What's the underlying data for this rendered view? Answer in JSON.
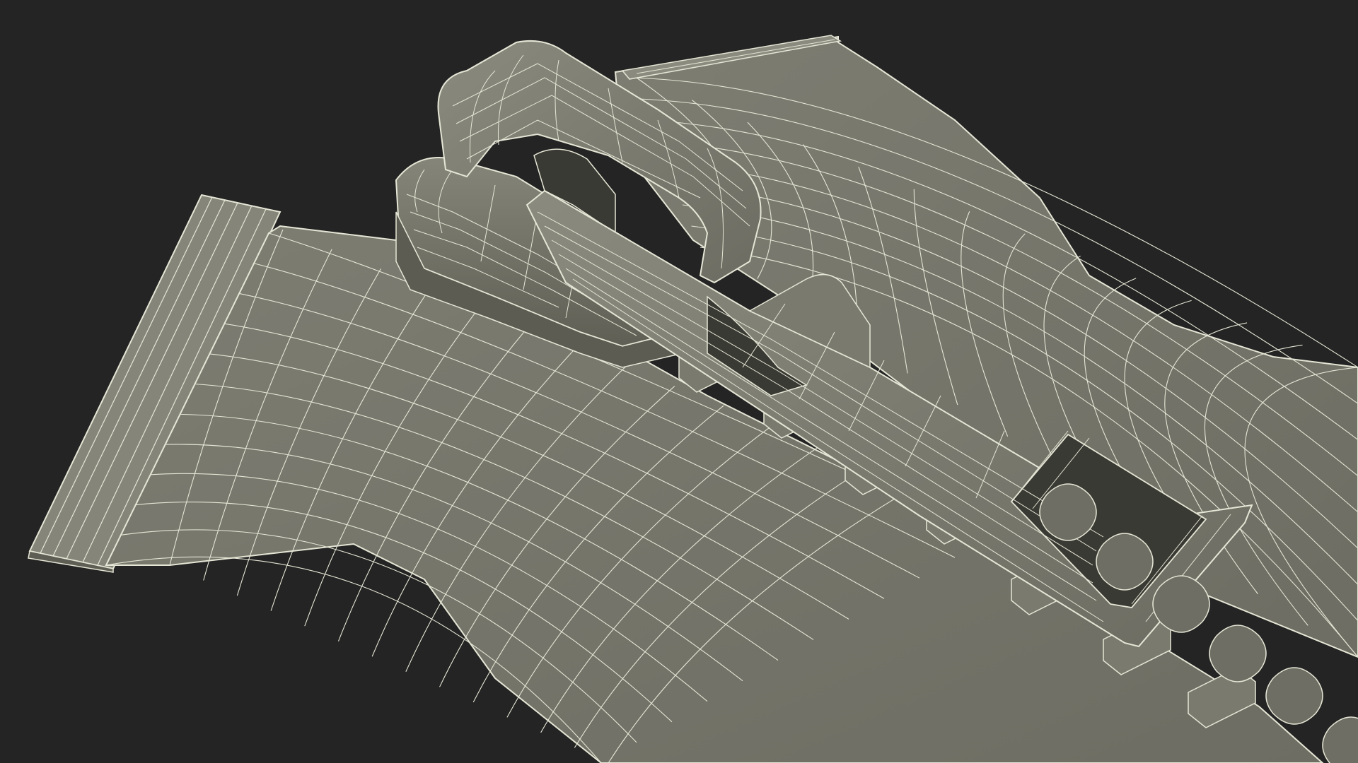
{
  "scene": {
    "subject": "zipper-slider-wireframe",
    "colors": {
      "background": "#242424",
      "surface": "#77776c",
      "surface_light": "#8a8a7e",
      "surface_dark": "#5f5f55",
      "shadow": "#4c4c44",
      "wire": "#e6e6d6"
    }
  }
}
